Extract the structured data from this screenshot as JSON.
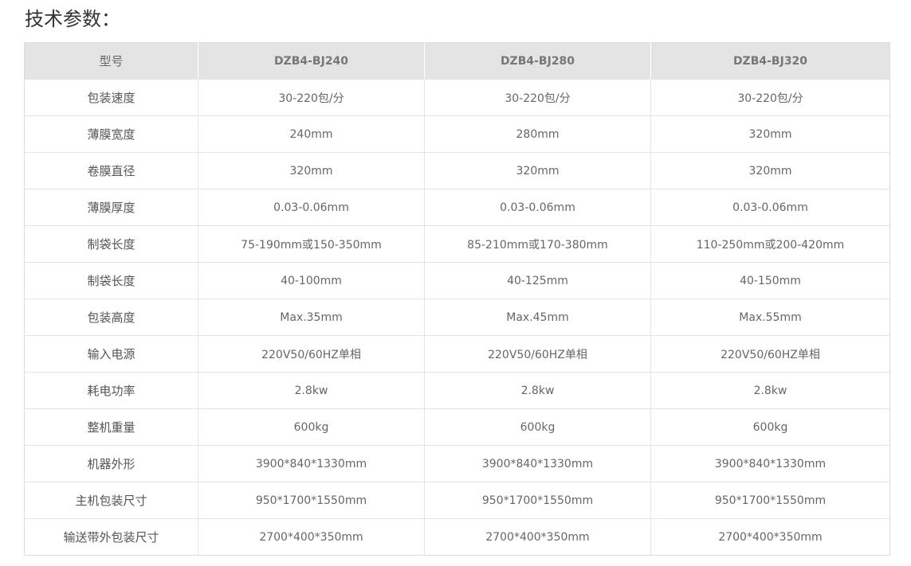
{
  "page": {
    "title": "技术参数："
  },
  "table": {
    "headers": [
      "型号",
      "DZB4-BJ240",
      "DZB4-BJ280",
      "DZB4-BJ320"
    ],
    "rows": [
      [
        "包装速度",
        "30-220包/分",
        "30-220包/分",
        "30-220包/分"
      ],
      [
        "薄膜宽度",
        "240mm",
        "280mm",
        "320mm"
      ],
      [
        "卷膜直径",
        "320mm",
        "320mm",
        "320mm"
      ],
      [
        "薄膜厚度",
        "0.03-0.06mm",
        "0.03-0.06mm",
        "0.03-0.06mm"
      ],
      [
        "制袋长度",
        "75-190mm或150-350mm",
        "85-210mm或170-380mm",
        "110-250mm或200-420mm"
      ],
      [
        "制袋长度",
        "40-100mm",
        "40-125mm",
        "40-150mm"
      ],
      [
        "包装高度",
        "Max.35mm",
        "Max.45mm",
        "Max.55mm"
      ],
      [
        "输入电源",
        "220V50/60HZ单相",
        "220V50/60HZ单相",
        "220V50/60HZ单相"
      ],
      [
        "耗电功率",
        "2.8kw",
        "2.8kw",
        "2.8kw"
      ],
      [
        "整机重量",
        "600kg",
        "600kg",
        "600kg"
      ],
      [
        "机器外形",
        "3900*840*1330mm",
        "3900*840*1330mm",
        "3900*840*1330mm"
      ],
      [
        "主机包装尺寸",
        "950*1700*1550mm",
        "950*1700*1550mm",
        "950*1700*1550mm"
      ],
      [
        "输送带外包装尺寸",
        "2700*400*350mm",
        "2700*400*350mm",
        "2700*400*350mm"
      ]
    ]
  }
}
